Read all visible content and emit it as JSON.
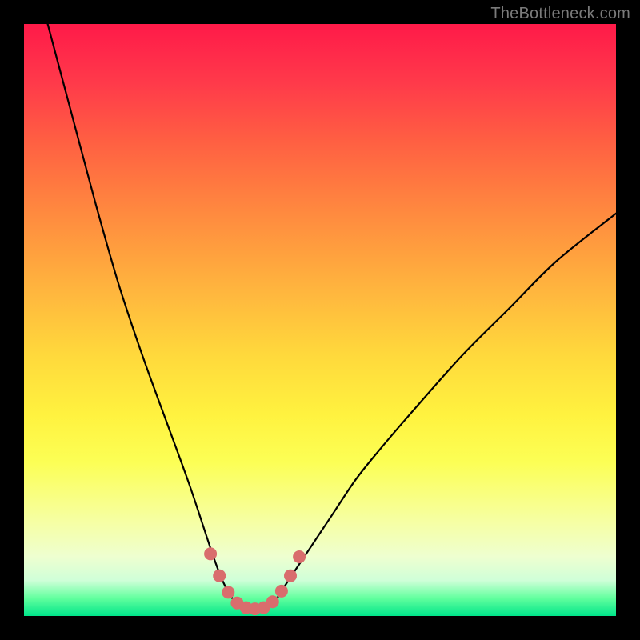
{
  "watermark": "TheBottleneck.com",
  "colors": {
    "background": "#000000",
    "gradient_top": "#ff1a49",
    "gradient_bottom": "#00e58a",
    "curve_stroke": "#000000",
    "dot_fill": "#d96d6d",
    "watermark_text": "#7b7b7b"
  },
  "chart_data": {
    "type": "line",
    "title": "",
    "xlabel": "",
    "ylabel": "",
    "xlim": [
      0,
      100
    ],
    "ylim": [
      0,
      100
    ],
    "grid": false,
    "legend": false,
    "note": "V-shaped bottleneck curve on vertical rainbow gradient. x and y are percentages of the inner plot area (x: left→right, y: bottom→top). Minimum (≈0) around x≈36–42.",
    "series": [
      {
        "name": "bottleneck-curve",
        "x": [
          4,
          8,
          12,
          16,
          20,
          24,
          28,
          32,
          34,
          36,
          38,
          40,
          42,
          44,
          48,
          52,
          56,
          60,
          66,
          74,
          82,
          90,
          100
        ],
        "y": [
          100,
          85,
          70,
          56,
          44,
          33,
          22,
          10,
          5,
          2,
          1,
          1,
          2,
          5,
          11,
          17,
          23,
          28,
          35,
          44,
          52,
          60,
          68
        ]
      }
    ],
    "trough_dots": {
      "name": "near-minimum-markers",
      "x": [
        31.5,
        33.0,
        34.5,
        36.0,
        37.5,
        39.0,
        40.5,
        42.0,
        43.5,
        45.0,
        46.5
      ],
      "y": [
        10.5,
        6.8,
        4.0,
        2.2,
        1.4,
        1.2,
        1.4,
        2.4,
        4.2,
        6.8,
        10.0
      ]
    }
  }
}
